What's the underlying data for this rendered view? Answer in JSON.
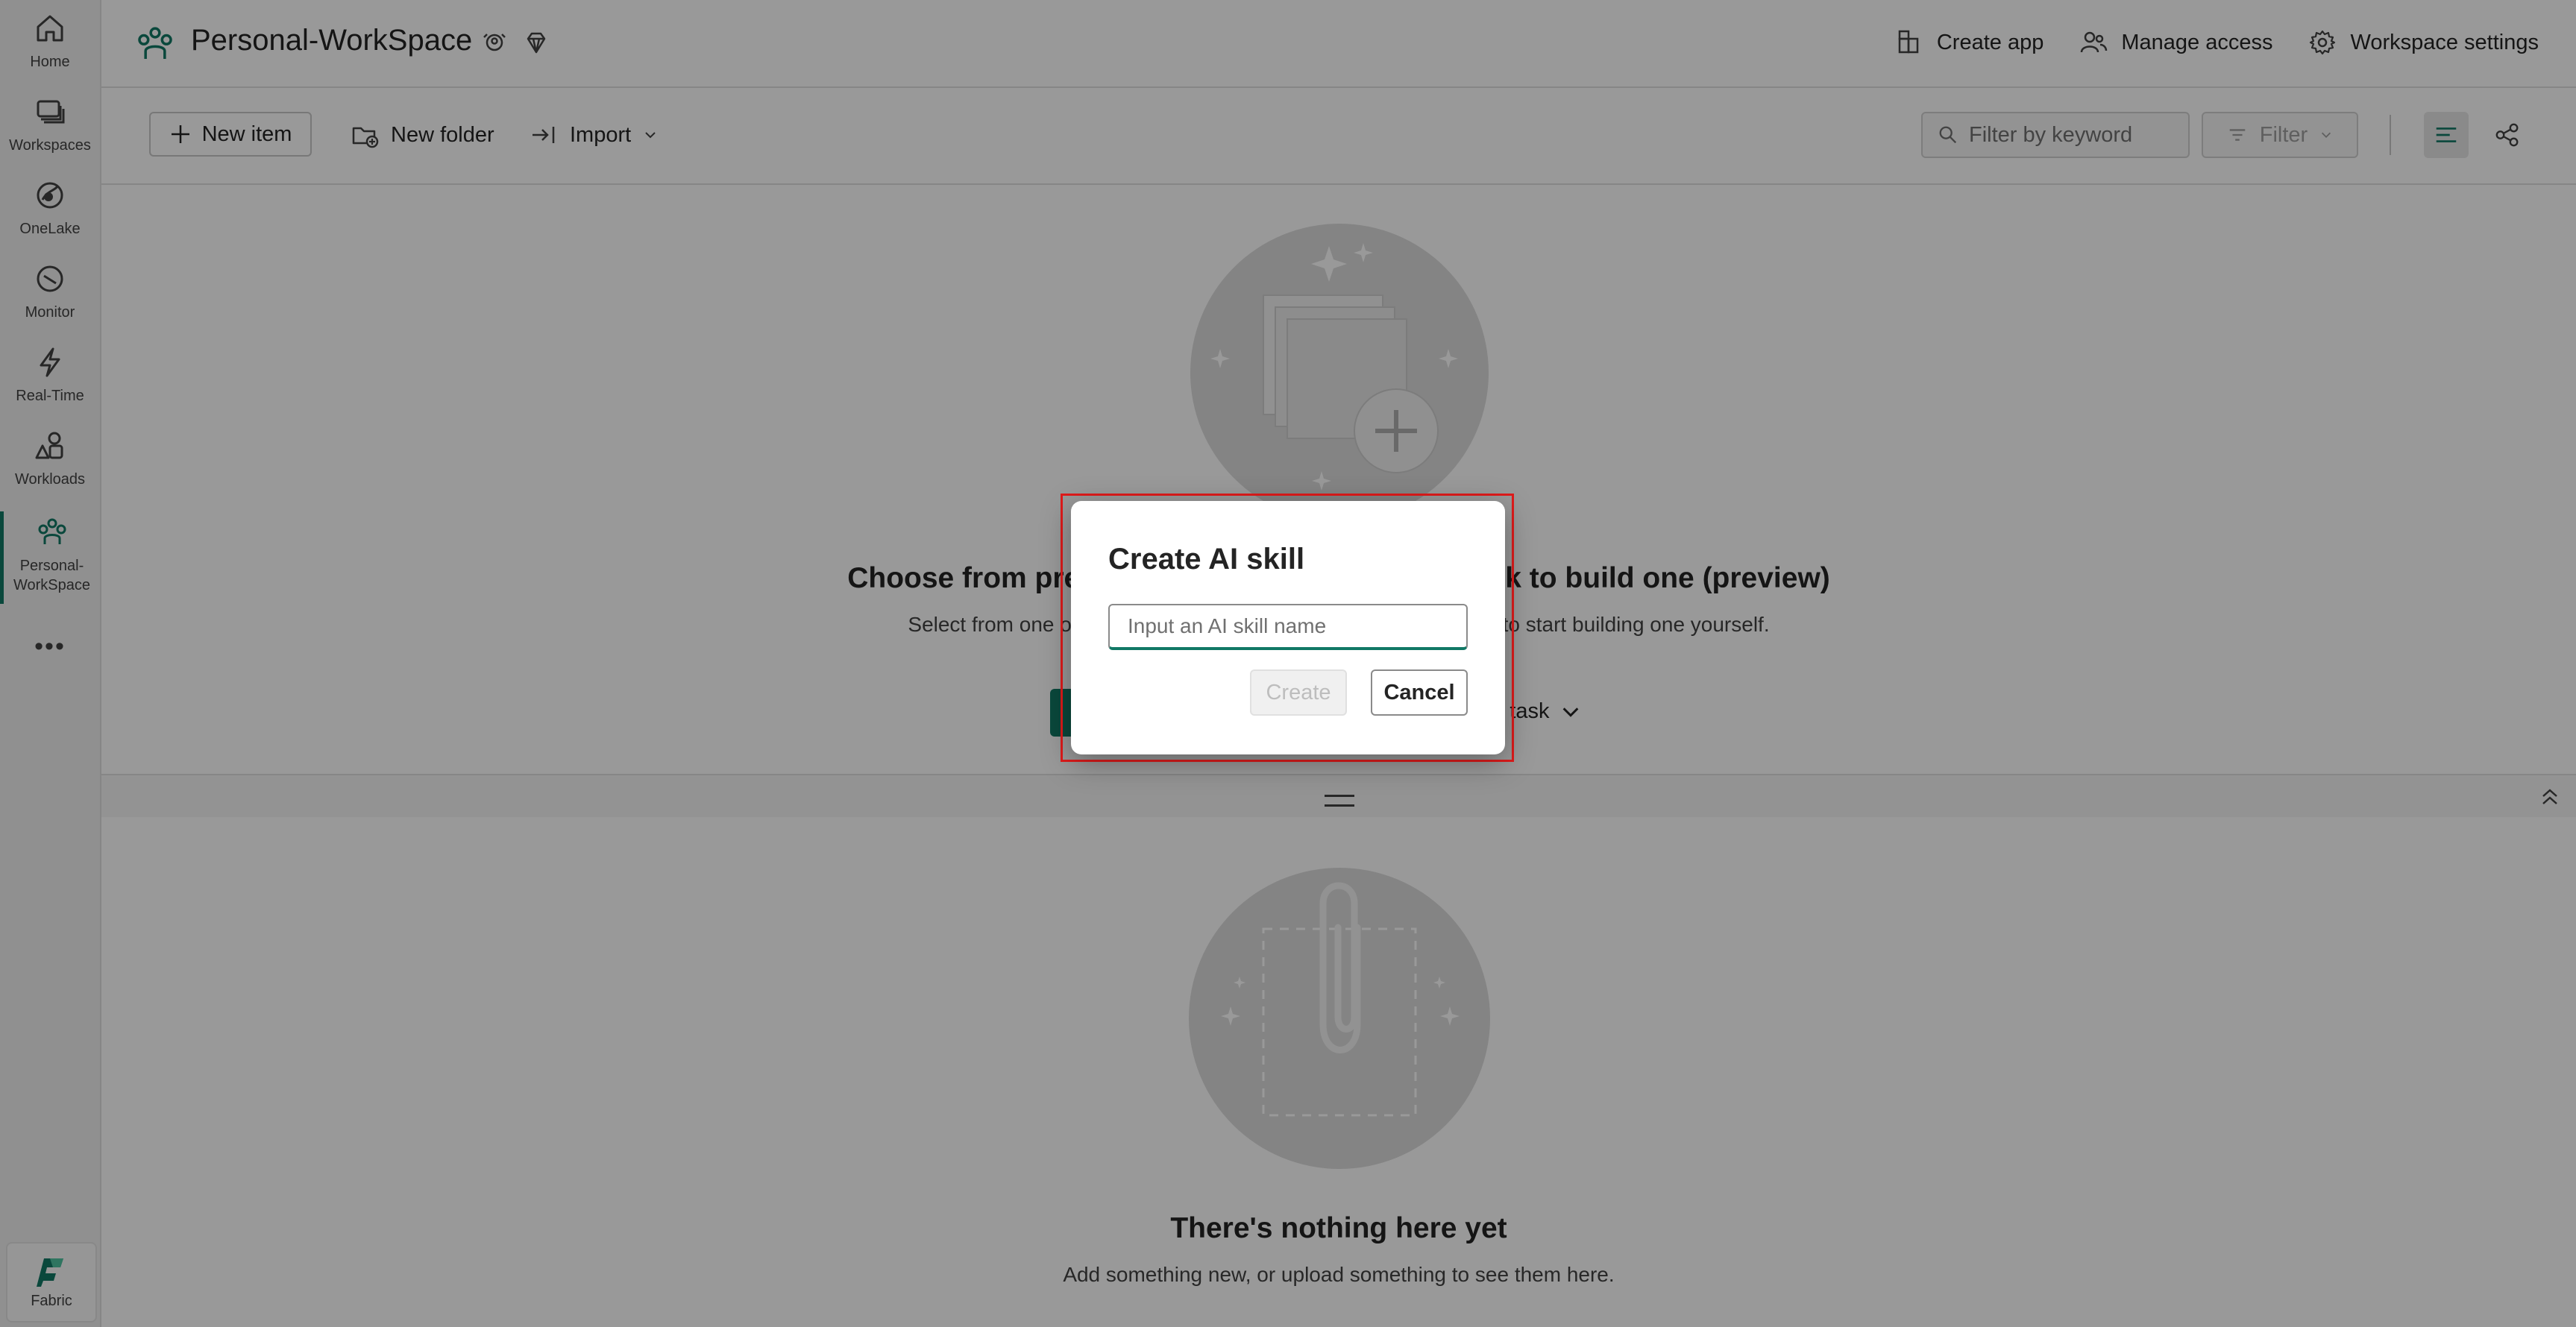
{
  "rail": {
    "items": [
      {
        "label": "Home",
        "icon": "home-icon"
      },
      {
        "label": "Workspaces",
        "icon": "workspaces-icon"
      },
      {
        "label": "OneLake",
        "icon": "onelake-icon"
      },
      {
        "label": "Monitor",
        "icon": "monitor-icon"
      },
      {
        "label": "Real-Time",
        "icon": "lightning-icon"
      },
      {
        "label": "Workloads",
        "icon": "workloads-icon"
      },
      {
        "label": "Personal-\nWorkSpace",
        "icon": "people-icon",
        "active": true
      }
    ],
    "more": "•••",
    "fabric_label": "Fabric"
  },
  "header": {
    "title": "Personal-WorkSpace",
    "actions": [
      {
        "label": "Create app",
        "icon": "create-app-icon"
      },
      {
        "label": "Manage access",
        "icon": "manage-access-icon"
      },
      {
        "label": "Workspace settings",
        "icon": "gear-icon"
      }
    ]
  },
  "toolbar": {
    "new_item": "New item",
    "new_folder": "New folder",
    "import": "Import",
    "filter_placeholder": "Filter by keyword",
    "filter_button": "Filter"
  },
  "upper": {
    "title_left": "Choose from pre",
    "title_right": "k to build one (preview)",
    "subtitle_left": "Select from one of",
    "subtitle_right": "to start building one yourself.",
    "task_link": "d a task"
  },
  "lower": {
    "title": "There's nothing here yet",
    "subtitle": "Add something new, or upload something to see them here."
  },
  "dialog": {
    "title": "Create AI skill",
    "input_placeholder": "Input an AI skill name",
    "input_value": "",
    "create_label": "Create",
    "cancel_label": "Cancel",
    "create_disabled": true
  },
  "colors": {
    "accent": "#117865",
    "highlight_outline": "#e01b1b",
    "overlay": "rgba(0,0,0,0.4)"
  }
}
